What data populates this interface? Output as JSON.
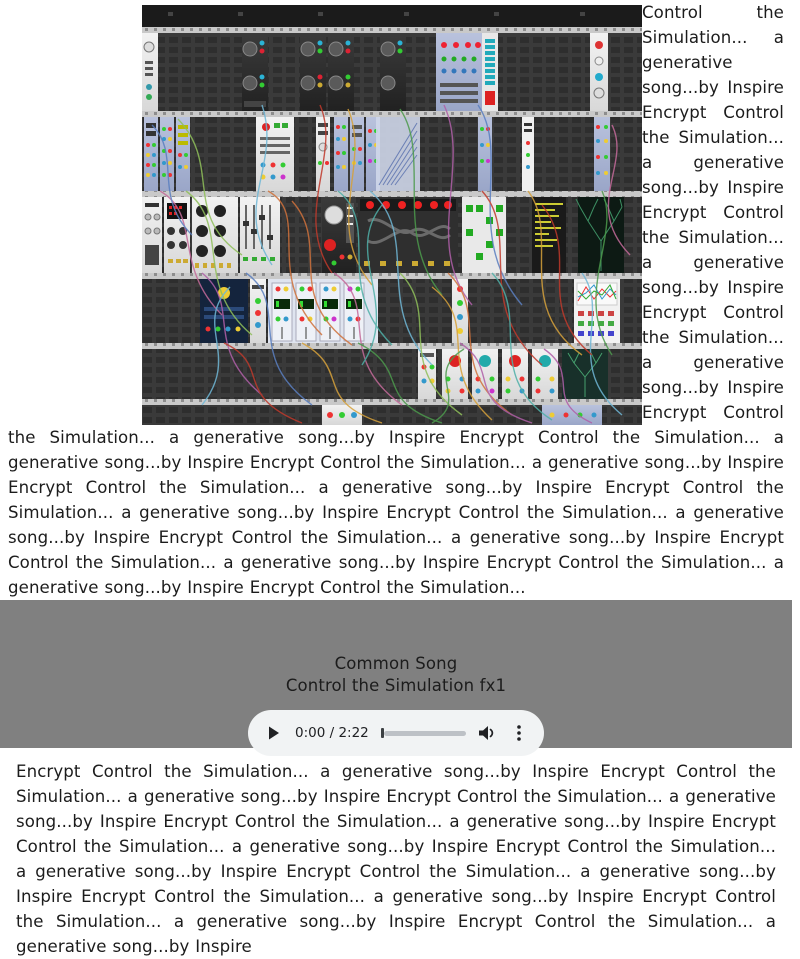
{
  "page": {
    "background_color": "#ffffff",
    "text_color": "#1c1c1c"
  },
  "top_text": {
    "content": "Control the Simulation... a generative song...by Inspire Encrypt Control the Simulation... a generative song...by Inspire Encrypt Control the Simulation... a generative song...by Inspire Encrypt Control the Simulation... a generative song...by Inspire Encrypt Control the Simulation... a generative song...by Inspire Encrypt Control the Simulation... a generative song...by Inspire Encrypt Control the Simulation... a generative song...by Inspire Encrypt Control the Simulation... a generative song...by Inspire Encrypt Control the Simulation... a generative song...by Inspire Encrypt Control the Simulation... a generative song...by Inspire Encrypt Control the Simulation... a generative song...by Inspire Encrypt Control the Simulation... a generative song...by Inspire Encrypt Control the Simulation... a generative song...by Inspire Encrypt Control the Simulation..."
  },
  "rack_image": {
    "alt": "modular-synthesizer-rack-patch",
    "description": "Dense VCV Rack style eurorack modular synthesizer patch with many rows of modules and colored patch cables",
    "background_color": "#2b2b2b",
    "rail_color": "#c8c8c8",
    "cable_colors": [
      "#6fb7d6",
      "#c0392b",
      "#d6a13a",
      "#4c9a4c",
      "#b05fa8",
      "#5a7fc0",
      "#c46a9a",
      "#8fbf5a",
      "#d0713a",
      "#4fb0a8"
    ]
  },
  "player_band": {
    "background_color": "#808080",
    "title": "Common Song",
    "subtitle": "Control the Simulation fx1",
    "audio_player": {
      "play_label": "play",
      "play_icon": "play-triangle-icon",
      "time_display": "0:00 / 2:22",
      "current_time": "0:00",
      "duration": "2:22",
      "progress_percent": 0,
      "volume_icon": "speaker-volume-icon",
      "menu_icon": "vertical-three-dots-icon",
      "surface_color": "#f1f3f4",
      "track_color": "#bdc1c6",
      "thumb_color": "#3c4043"
    }
  },
  "bottom_text": {
    "content": "Encrypt Control the Simulation... a generative song...by Inspire Encrypt Control the Simulation... a generative song...by Inspire Encrypt Control the Simulation... a generative song...by Inspire Encrypt Control the Simulation... a generative song...by Inspire Encrypt Control the Simulation... a generative song...by Inspire Encrypt Control the Simulation... a generative song...by Inspire Encrypt Control the Simulation... a generative song...by Inspire Encrypt Control the Simulation... a generative song...by Inspire Encrypt Control the Simulation... a generative song...by Inspire Encrypt Control the Simulation... a generative song...by Inspire"
  }
}
